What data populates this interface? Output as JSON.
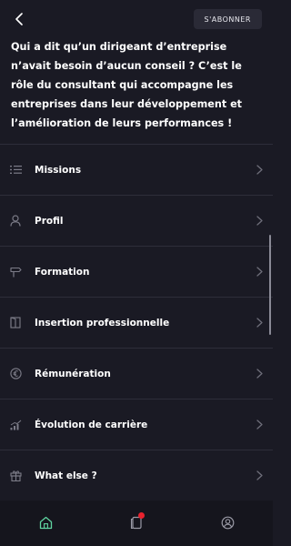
{
  "header": {
    "subscribe_label": "S'ABONNER"
  },
  "intro": {
    "text": "Qui a dit qu’un dirigeant d’entreprise n’avait besoin d’aucun conseil ? C’est le rôle du consultant qui accompagne les entreprises dans leur développement et l’amélioration de leurs performances !"
  },
  "menu": {
    "items": [
      {
        "label": "Missions",
        "icon": "list-icon"
      },
      {
        "label": "Profil",
        "icon": "user-icon"
      },
      {
        "label": "Formation",
        "icon": "signpost-icon"
      },
      {
        "label": "Insertion professionnelle",
        "icon": "door-icon"
      },
      {
        "label": "Rémunération",
        "icon": "euro-icon"
      },
      {
        "label": "Évolution de carrière",
        "icon": "growth-chart-icon"
      },
      {
        "label": "What else ?",
        "icon": "gift-icon"
      }
    ]
  },
  "bottom_nav": {
    "items": [
      {
        "icon": "home-icon",
        "active": true
      },
      {
        "icon": "cards-icon",
        "badge": true
      },
      {
        "icon": "profile-icon"
      }
    ]
  },
  "colors": {
    "background": "#1a1a24",
    "nav_background": "#15151d",
    "active_accent": "#5fd3a0",
    "badge": "#e8222e",
    "divider": "#2e2e3a"
  }
}
